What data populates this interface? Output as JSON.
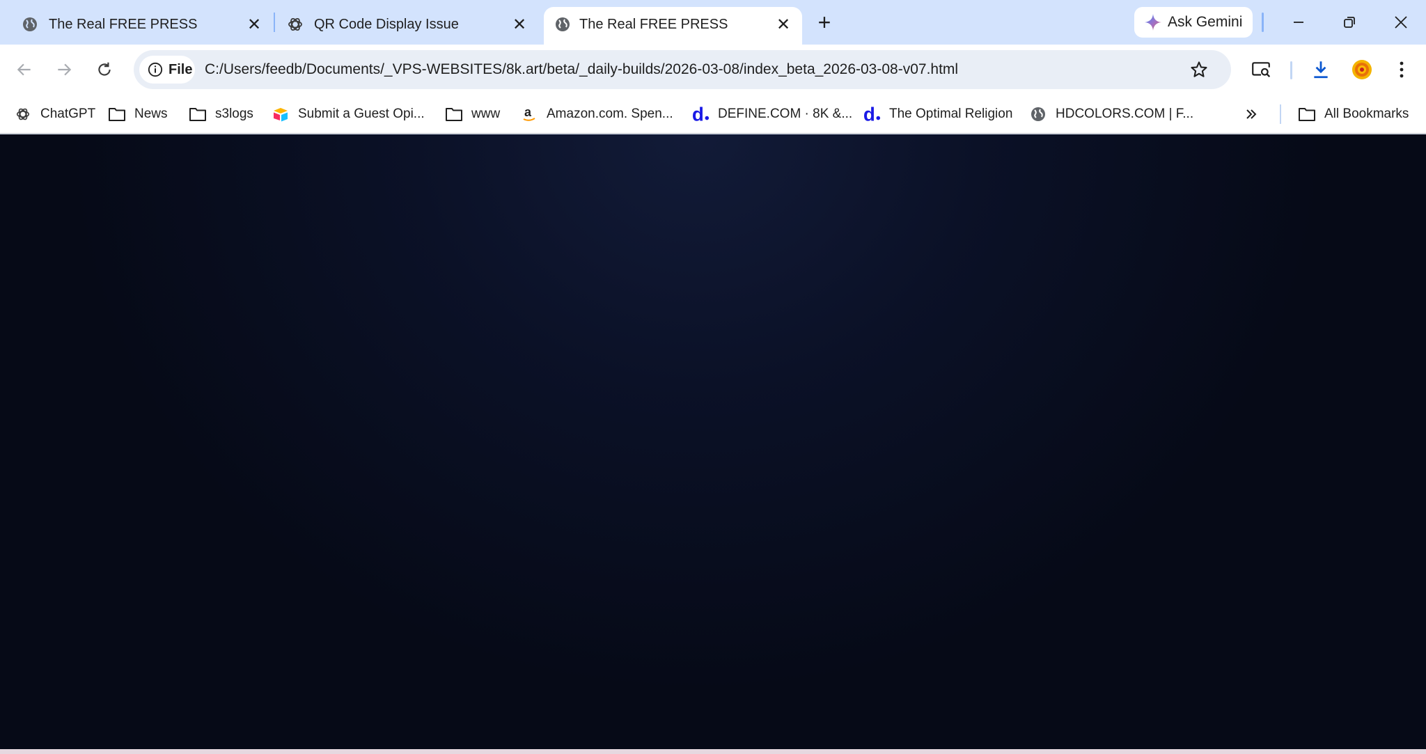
{
  "tabs": [
    {
      "title": "The Real FREE PRESS",
      "favicon": "globe-icon",
      "active": false
    },
    {
      "title": "QR Code Display Issue",
      "favicon": "chatgpt-icon",
      "active": false
    },
    {
      "title": "The Real FREE PRESS",
      "favicon": "globe-icon",
      "active": true
    }
  ],
  "gemini_label": "Ask Gemini",
  "omnibox": {
    "chip_label": "File",
    "url": "C:/Users/feedb/Documents/_VPS-WEBSITES/8k.art/beta/_daily-builds/2026-03-08/index_beta_2026-03-08-v07.html"
  },
  "bookmarks": [
    {
      "label": "ChatGPT",
      "icon": "chatgpt-icon"
    },
    {
      "label": "News",
      "icon": "folder-icon"
    },
    {
      "label": "s3logs",
      "icon": "folder-icon"
    },
    {
      "label": "Submit a Guest Opi...",
      "icon": "airtable-icon"
    },
    {
      "label": "www",
      "icon": "folder-icon"
    },
    {
      "label": "Amazon.com. Spen...",
      "icon": "amazon-icon"
    },
    {
      "label": "DEFINE.COM · 8K &...",
      "icon": "define-d-icon"
    },
    {
      "label": "The Optimal Religion",
      "icon": "define-d-icon"
    },
    {
      "label": "HDCOLORS.COM | F...",
      "icon": "globe-icon"
    }
  ],
  "all_bookmarks_label": "All Bookmarks",
  "colors": {
    "tabstrip": "#d3e3fd",
    "omnibox": "#e9eef6",
    "page_bg": "#0b1127",
    "download_accent": "#0b57d0"
  }
}
